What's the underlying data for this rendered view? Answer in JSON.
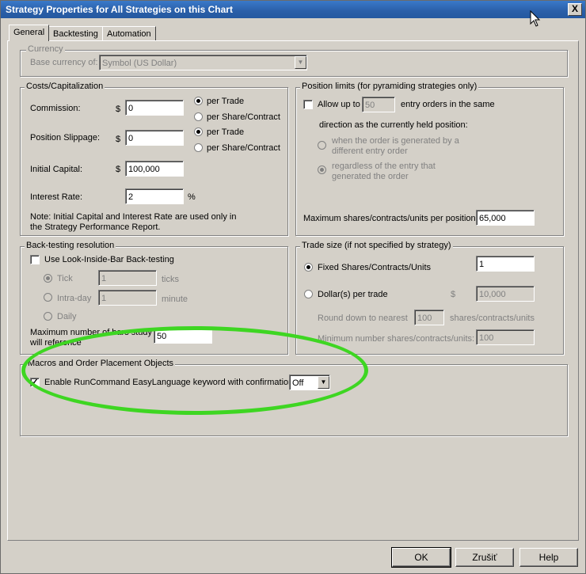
{
  "window": {
    "title": "Strategy Properties for All Strategies on this Chart",
    "close_label": "X"
  },
  "tabs": [
    {
      "label": "General",
      "active": true
    },
    {
      "label": "Backtesting",
      "active": false
    },
    {
      "label": "Automation",
      "active": false
    }
  ],
  "currency": {
    "legend": "Currency",
    "base_label": "Base currency of:",
    "base_value": "Symbol (US Dollar)"
  },
  "costs": {
    "legend": "Costs/Capitalization",
    "commission_label": "Commission:",
    "commission_currency": "$",
    "commission_value": "0",
    "commission_mode": "per Trade",
    "per_trade_label": "per Trade",
    "per_share_label": "per Share/Contract",
    "slippage_label": "Position Slippage:",
    "slippage_currency": "$",
    "slippage_value": "0",
    "slippage_mode": "per Trade",
    "initial_capital_label": "Initial Capital:",
    "initial_capital_currency": "$",
    "initial_capital_value": "100,000",
    "interest_rate_label": "Interest Rate:",
    "interest_rate_value": "2",
    "interest_rate_unit": "%",
    "note_line1": "Note: Initial Capital and Interest Rate are used only in",
    "note_line2": "the Strategy Performance Report."
  },
  "position_limits": {
    "legend": "Position limits (for pyramiding strategies only)",
    "allow_label": "Allow up to",
    "allow_checked": false,
    "allow_value": "50",
    "entry_orders_label": "entry orders in the same",
    "direction_label": "direction as the currently held position:",
    "opt1_line1": "when the order is generated by a",
    "opt1_line2": "different entry order",
    "opt2_line1": "regardless of the entry that",
    "opt2_line2": "generated the order",
    "selected_option": 2,
    "max_shares_label": "Maximum shares/contracts/units per position",
    "max_shares_value": "65,000"
  },
  "backtesting_resolution": {
    "legend": "Back-testing resolution",
    "look_inside_label": "Use Look-Inside-Bar Back-testing",
    "look_inside_checked": false,
    "tick_label": "Tick",
    "tick_value": "1",
    "ticks_unit": "ticks",
    "intraday_label": "Intra-day",
    "intraday_value": "1",
    "minute_unit": "minute",
    "daily_label": "Daily",
    "selected": "Tick",
    "max_bars_line1": "Maximum number of bars study",
    "max_bars_line2": "will reference",
    "max_bars_value": "50"
  },
  "trade_size": {
    "legend": "Trade size (if not specified by strategy)",
    "fixed_label": "Fixed Shares/Contracts/Units",
    "fixed_value": "1",
    "dollars_label": "Dollar(s) per trade",
    "dollars_currency": "$",
    "dollars_value": "10,000",
    "selected": "fixed",
    "round_label": "Round down to nearest",
    "round_value": "100",
    "round_unit": "shares/contracts/units",
    "min_label": "Minimum number shares/contracts/units:",
    "min_value": "100"
  },
  "macros": {
    "legend": "Macros and Order Placement Objects",
    "enable_label": "Enable RunCommand EasyLanguage keyword with confirmation",
    "enable_checked": true,
    "select_value": "Off"
  },
  "buttons": {
    "ok": "OK",
    "cancel": "Zrušiť",
    "help": "Help"
  },
  "colors": {
    "highlight": "#3ed622",
    "titlebar": "#2a5fa8",
    "dialog_bg": "#d4d0c8"
  }
}
